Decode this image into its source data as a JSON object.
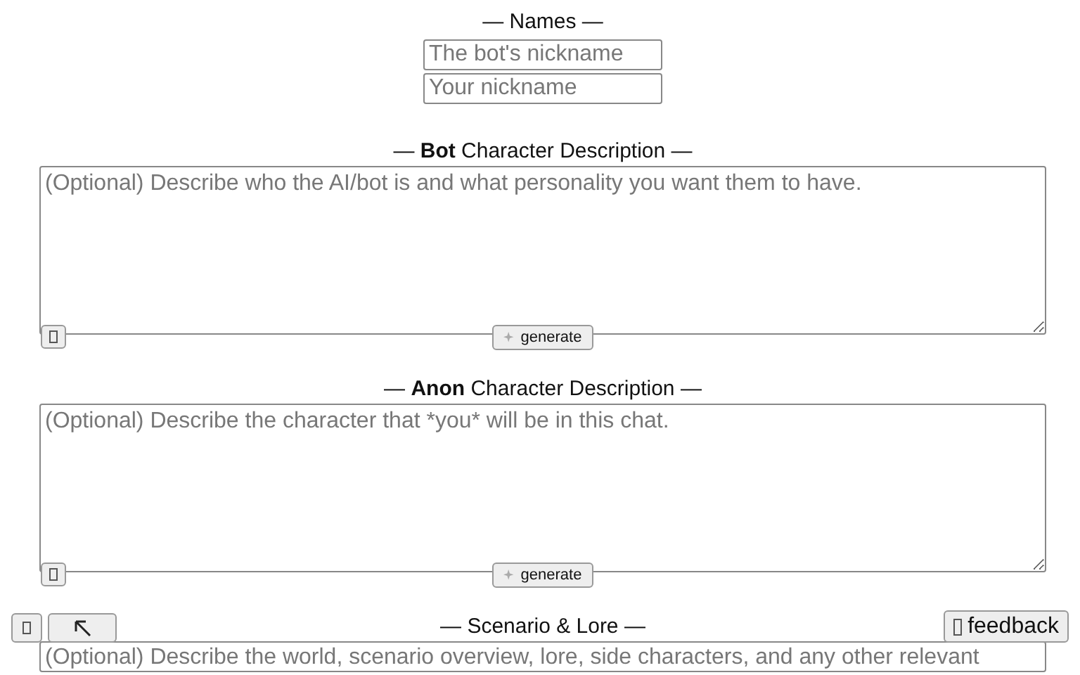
{
  "names": {
    "heading": "— Names —",
    "fields": [
      {
        "placeholder": "The bot's nickname"
      },
      {
        "placeholder": "Your nickname"
      }
    ]
  },
  "sections": [
    {
      "heading": "— **Bot** Character Description —",
      "placeholder": "(Optional) Describe who the AI/bot is and what personality you want them to have.",
      "generate": "generate"
    },
    {
      "heading": "— **Anon** Character Description —",
      "placeholder": "(Optional) Describe the character that *you* will be in this chat.",
      "generate": "generate"
    },
    {
      "heading": "— Scenario & Lore —",
      "placeholder": "(Optional) Describe the world, scenario overview, lore, side characters, and any other relevant"
    }
  ],
  "feedback": "feedback"
}
